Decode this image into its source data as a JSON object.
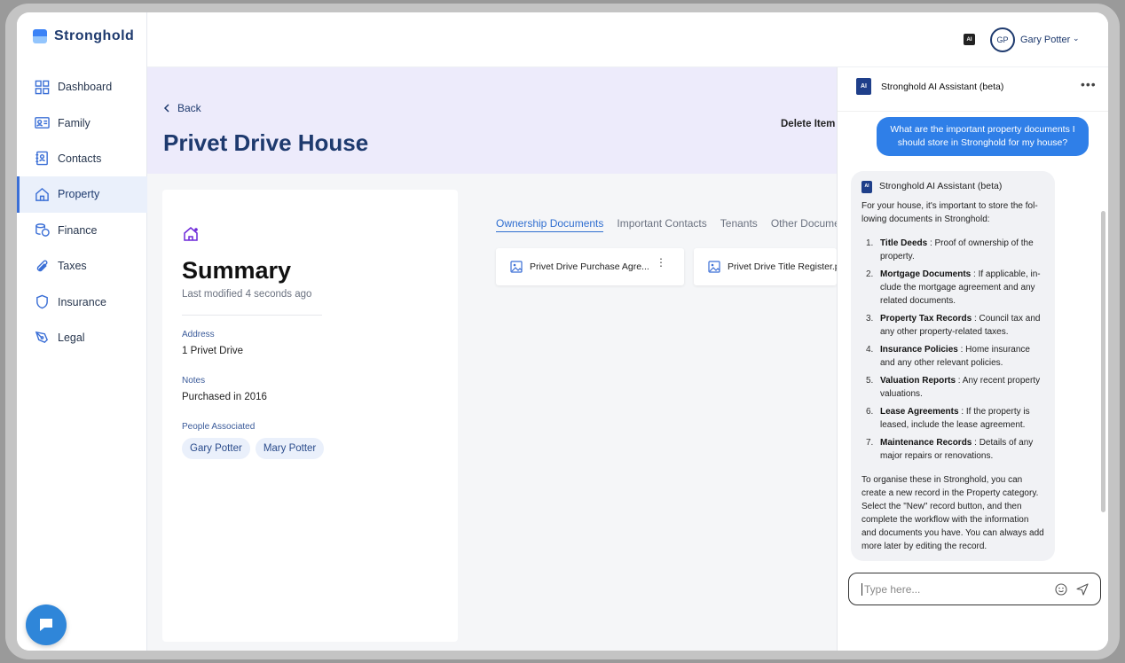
{
  "app": {
    "name": "Stronghold"
  },
  "sidebar": {
    "items": [
      {
        "label": "Dashboard",
        "icon": "grid-icon"
      },
      {
        "label": "Family",
        "icon": "id-card-icon"
      },
      {
        "label": "Contacts",
        "icon": "contact-book-icon"
      },
      {
        "label": "Property",
        "icon": "home-icon",
        "active": true
      },
      {
        "label": "Finance",
        "icon": "coins-icon"
      },
      {
        "label": "Taxes",
        "icon": "paperclip-icon"
      },
      {
        "label": "Insurance",
        "icon": "shield-icon"
      },
      {
        "label": "Legal",
        "icon": "pen-icon"
      }
    ]
  },
  "topbar": {
    "ai_badge": "AI",
    "user_initials": "GP",
    "user_name": "Gary Potter"
  },
  "header": {
    "back_label": "Back",
    "title": "Privet Drive House",
    "delete_label": "Delete Item"
  },
  "summary": {
    "title": "Summary",
    "modified": "Last modified 4 seconds ago",
    "address_label": "Address",
    "address": "1 Privet Drive",
    "notes_label": "Notes",
    "notes": "Purchased in 2016",
    "people_label": "People Associated",
    "people": [
      "Gary Potter",
      "Mary Potter"
    ]
  },
  "tabs": [
    "Ownership Documents",
    "Important Contacts",
    "Tenants",
    "Other Documents"
  ],
  "documents": [
    "Privet Drive Purchase Agre...",
    "Privet Drive Title Register.pdf"
  ],
  "ai": {
    "logo": "AI",
    "title": "Stronghold AI Assistant (beta)",
    "user_message": "What are the important property documents I should store in Stronghold for my house?",
    "bot_name": "Stronghold AI Assistant (beta)",
    "bot_intro": "For your house, it's important to store the fol-lowing documents in Stronghold:",
    "bot_items": [
      {
        "n": "1.",
        "title": "Title Deeds",
        "text": " : Proof of ownership of the property."
      },
      {
        "n": "2.",
        "title": "Mortgage Documents",
        "text": " : If applicable, in-clude the mortgage agreement and any related documents."
      },
      {
        "n": "3.",
        "title": "Property Tax Records",
        "text": " : Council tax and any other property-related taxes."
      },
      {
        "n": "4.",
        "title": "Insurance Policies",
        "text": " : Home insurance and any other relevant policies."
      },
      {
        "n": "5.",
        "title": "Valuation Reports",
        "text": " : Any recent property valuations."
      },
      {
        "n": "6.",
        "title": "Lease Agreements",
        "text": " : If the property is leased, include the lease agreement."
      },
      {
        "n": "7.",
        "title": "Maintenance Records",
        "text": " : Details of any major repairs or renovations."
      }
    ],
    "bot_outro": "To organise these in Stronghold, you can create a new record in the Property category. Select the \"New\" record button, and then complete the workflow with the information and documents you have. You can always add more later by editing the record.",
    "input_placeholder": "Type here..."
  },
  "colors": {
    "brand": "#1e3a6e",
    "accent": "#2f7fe8",
    "header_bg": "#edebfb"
  }
}
